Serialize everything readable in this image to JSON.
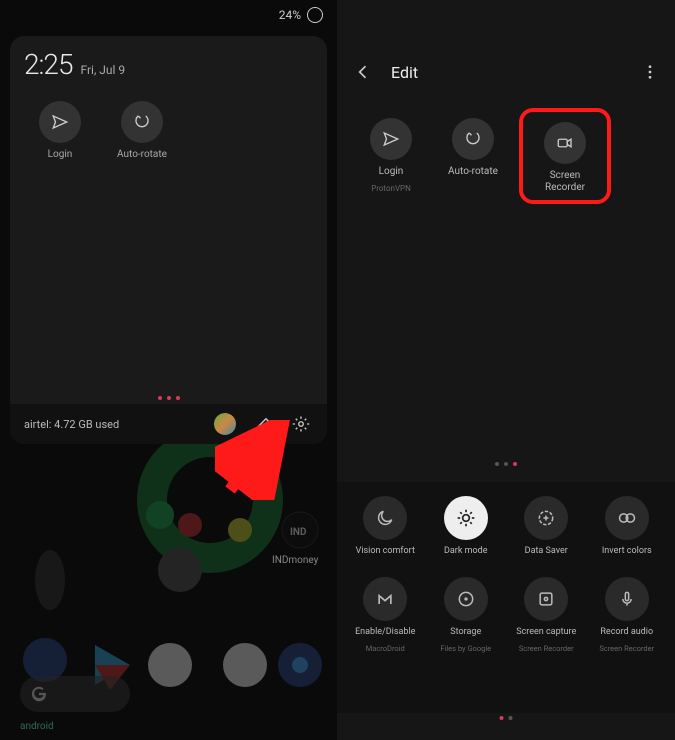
{
  "status": {
    "battery": "24%"
  },
  "clock": {
    "time": "2:25",
    "date": "Fri, Jul 9"
  },
  "qs_left": [
    {
      "label": "Login",
      "icon": "send"
    },
    {
      "label": "Auto-rotate",
      "icon": "rotate"
    }
  ],
  "footer": {
    "text": "airtel: 4.72 GB used"
  },
  "ind_label": "INDmoney",
  "android_label": "android",
  "edit": {
    "title": "Edit",
    "tiles": [
      {
        "label": "Login",
        "sub": "ProtonVPN",
        "icon": "send"
      },
      {
        "label": "Auto-rotate",
        "sub": "",
        "icon": "rotate"
      },
      {
        "label": "Screen Recorder",
        "sub": "",
        "icon": "video",
        "highlighted": true
      }
    ]
  },
  "lower": {
    "row1": [
      {
        "label": "Vision comfort",
        "sub": "",
        "icon": "moon"
      },
      {
        "label": "Dark mode",
        "sub": "",
        "icon": "sun",
        "on": true
      },
      {
        "label": "Data Saver",
        "sub": "",
        "icon": "data"
      },
      {
        "label": "Invert colors",
        "sub": "",
        "icon": "invert"
      }
    ],
    "row2": [
      {
        "label": "Enable/Disable",
        "sub": "MacroDroid",
        "icon": "m"
      },
      {
        "label": "Storage",
        "sub": "Files by Google",
        "icon": "disc"
      },
      {
        "label": "Screen capture",
        "sub": "Screen Recorder",
        "icon": "capture"
      },
      {
        "label": "Record audio",
        "sub": "Screen Recorder",
        "icon": "mic"
      }
    ]
  }
}
